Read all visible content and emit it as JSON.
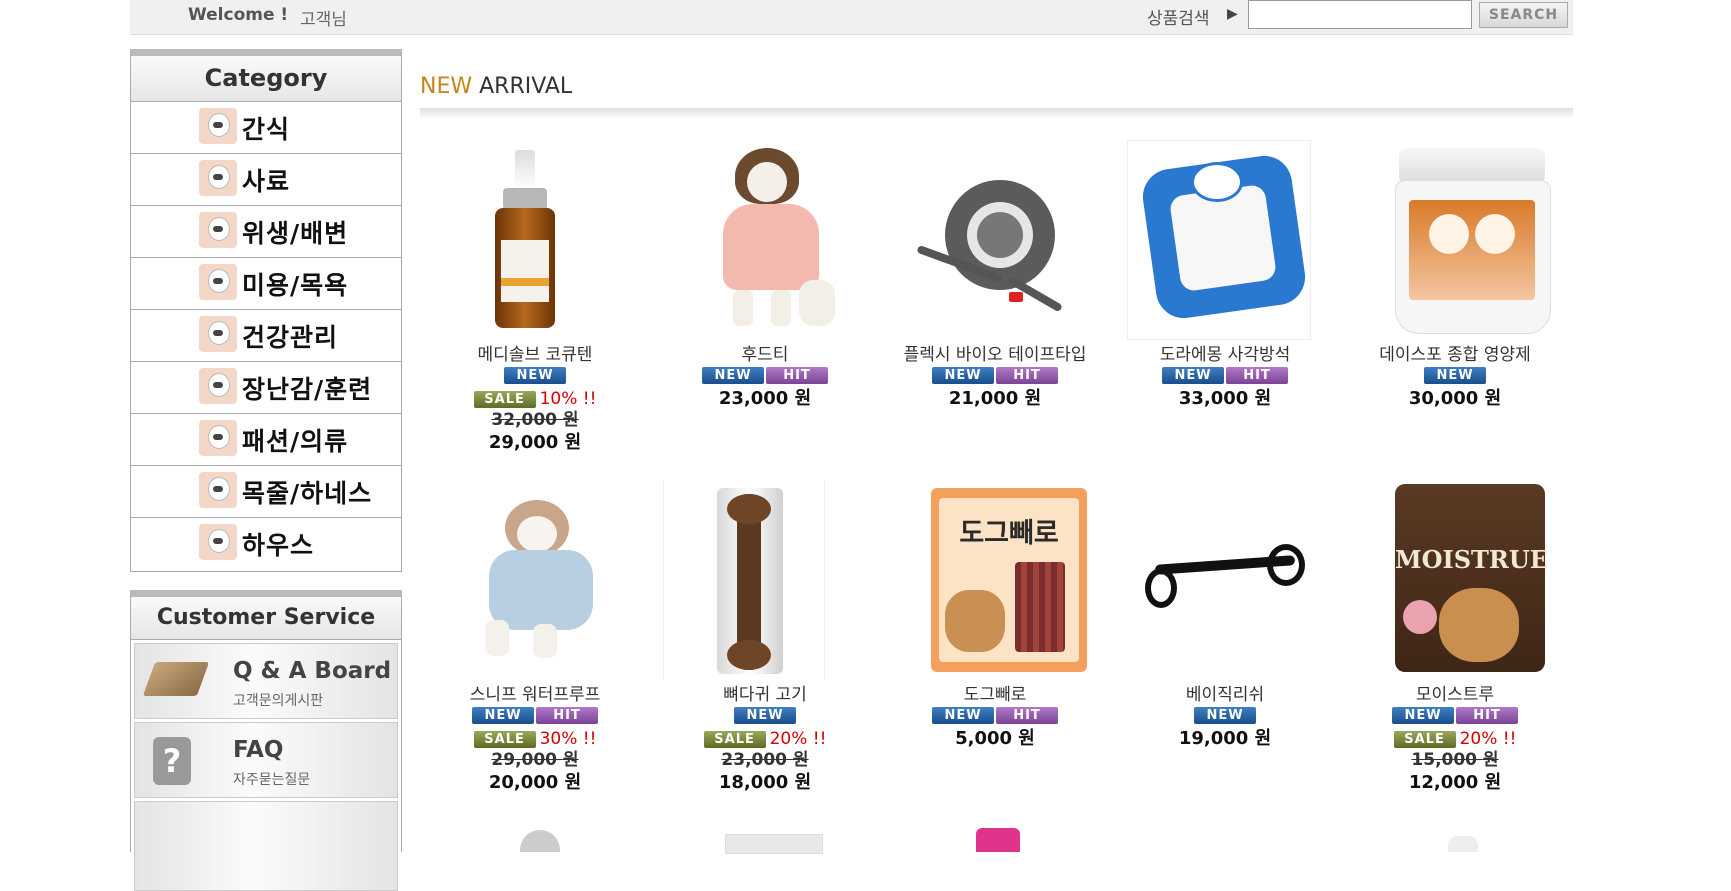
{
  "topbar": {
    "welcome": "Welcome !",
    "customer": "고객님",
    "search_label": "상품검색",
    "search_arrow": "▶",
    "search_placeholder": "",
    "search_button": "SEARCH"
  },
  "sidebar": {
    "category_title": "Category",
    "categories": [
      {
        "label": "간식"
      },
      {
        "label": "사료"
      },
      {
        "label": "위생/배변"
      },
      {
        "label": "미용/목욕"
      },
      {
        "label": "건강관리"
      },
      {
        "label": "장난감/훈련"
      },
      {
        "label": "패션/의류"
      },
      {
        "label": "목줄/하네스"
      },
      {
        "label": "하우스"
      }
    ],
    "cs_title": "Customer Service",
    "cs_items": [
      {
        "title": "Q & A Board",
        "subtitle": "고객문의게시판"
      },
      {
        "title": "FAQ",
        "subtitle": "자주묻는질문",
        "icon_text": "?"
      }
    ]
  },
  "main": {
    "section_title_new": "NEW",
    "section_title_arrival": "ARRIVAL",
    "products": [
      {
        "name": "메디솔브 코큐텐",
        "badges": [
          "NEW"
        ],
        "sale": "SALE",
        "discount": "10% !!",
        "original_price": "32,000 원",
        "price": "29,000 원",
        "image": "serum-bottle"
      },
      {
        "name": "후드티",
        "badges": [
          "NEW",
          "HIT"
        ],
        "price": "23,000 원",
        "image": "dog-pink-hoodie"
      },
      {
        "name": "플렉시 바이오 테이프타입",
        "badges": [
          "NEW",
          "HIT"
        ],
        "price": "21,000 원",
        "image": "retractable-leash"
      },
      {
        "name": "도라에몽 사각방석",
        "badges": [
          "NEW",
          "HIT"
        ],
        "price": "33,000 원",
        "image": "blue-pet-bed"
      },
      {
        "name": "데이스포 종합 영양제",
        "badges": [
          "NEW"
        ],
        "price": "30,000 원",
        "image": "supplement-jar"
      },
      {
        "name": "스니프 워터프루프",
        "badges": [
          "NEW",
          "HIT"
        ],
        "sale": "SALE",
        "discount": "30% !!",
        "original_price": "29,000 원",
        "price": "20,000 원",
        "image": "dog-blue-vest"
      },
      {
        "name": "뼈다귀 고기",
        "badges": [
          "NEW"
        ],
        "sale": "SALE",
        "discount": "20% !!",
        "original_price": "23,000 원",
        "price": "18,000 원",
        "image": "bone-treat"
      },
      {
        "name": "도그빼로",
        "badges": [
          "NEW",
          "HIT"
        ],
        "price": "5,000 원",
        "image": "treat-bag",
        "image_text": "도그빼로"
      },
      {
        "name": "베이직리쉬",
        "badges": [
          "NEW"
        ],
        "price": "19,000 원",
        "image": "black-leash"
      },
      {
        "name": "모이스트루",
        "badges": [
          "NEW",
          "HIT"
        ],
        "sale": "SALE",
        "discount": "20% !!",
        "original_price": "15,000 원",
        "price": "12,000 원",
        "image": "food-pouch",
        "image_text": "MOISTRUE"
      }
    ]
  },
  "colors": {
    "badge_new": "#1a4e8c",
    "badge_hit": "#7b4394",
    "badge_sale": "#5e6b25",
    "discount": "#d40000",
    "new_title": "#c8841b"
  }
}
